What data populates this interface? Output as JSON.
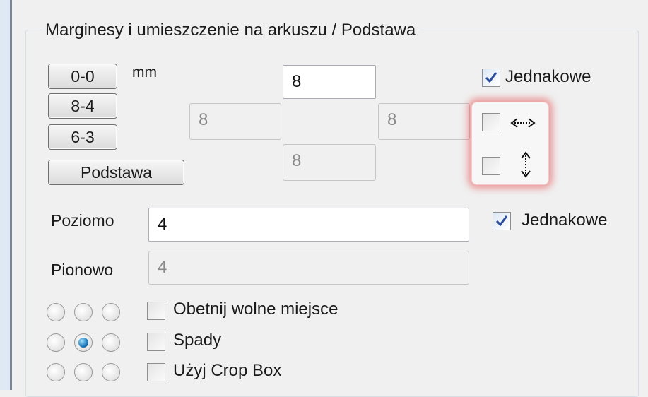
{
  "group": {
    "title": "Marginesy i umieszczenie na arkuszu / Podstawa"
  },
  "presets": {
    "unit_label": "mm",
    "buttons": [
      "0-0",
      "8-4",
      "6-3",
      "Podstawa"
    ]
  },
  "margins": {
    "top": "8",
    "left": "8",
    "right": "8",
    "bottom": "8",
    "same_label": "Jednakowe",
    "same_checked": true,
    "mirror_horizontal_checked": false,
    "mirror_vertical_checked": false
  },
  "spacing": {
    "horizontal_label": "Poziomo",
    "horizontal_value": "4",
    "vertical_label": "Pionowo",
    "vertical_value": "4",
    "same_label": "Jednakowe",
    "same_checked": true
  },
  "alignment": {
    "selected_row": 1,
    "selected_col": 1
  },
  "options": {
    "trim_label": "Obetnij wolne miejsce",
    "trim_checked": false,
    "bleed_label": "Spady",
    "bleed_checked": false,
    "cropbox_label": "Użyj Crop Box",
    "cropbox_checked": false
  },
  "colors": {
    "highlight": "#e65050",
    "check": "#2b4d9b",
    "radio_selected": "#1b76b8"
  },
  "icons": {
    "horizontal_mirror": "left-right-arrow-icon",
    "vertical_mirror": "up-down-arrow-icon"
  }
}
